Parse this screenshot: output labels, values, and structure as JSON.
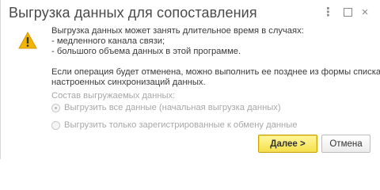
{
  "window": {
    "title": "Выгрузка данных для сопоставления",
    "more_glyph": "⋮",
    "close_glyph": "×"
  },
  "message": {
    "line1": "Выгрузка данных может занять длительное время в случаях:",
    "line2": " - медленного канала связи;",
    "line3": " - большого объема данных в этой программе.",
    "line4": "Если операция будет отменена, можно выполнить ее позднее из формы списка",
    "line5": "настроенных синхронизаций данных."
  },
  "options": {
    "group_label": "Состав выгружаемых данных:",
    "option_all": "Выгрузить все данные (начальная выгрузка данных)",
    "option_registered": "Выгрузить только зарегистрированные к обмену данные",
    "selected": "option_all"
  },
  "buttons": {
    "next_label": "Далее >",
    "cancel_label": "Отмена"
  },
  "colors": {
    "accent_button": "#f5e04a",
    "warning_icon": "#f2b400"
  }
}
